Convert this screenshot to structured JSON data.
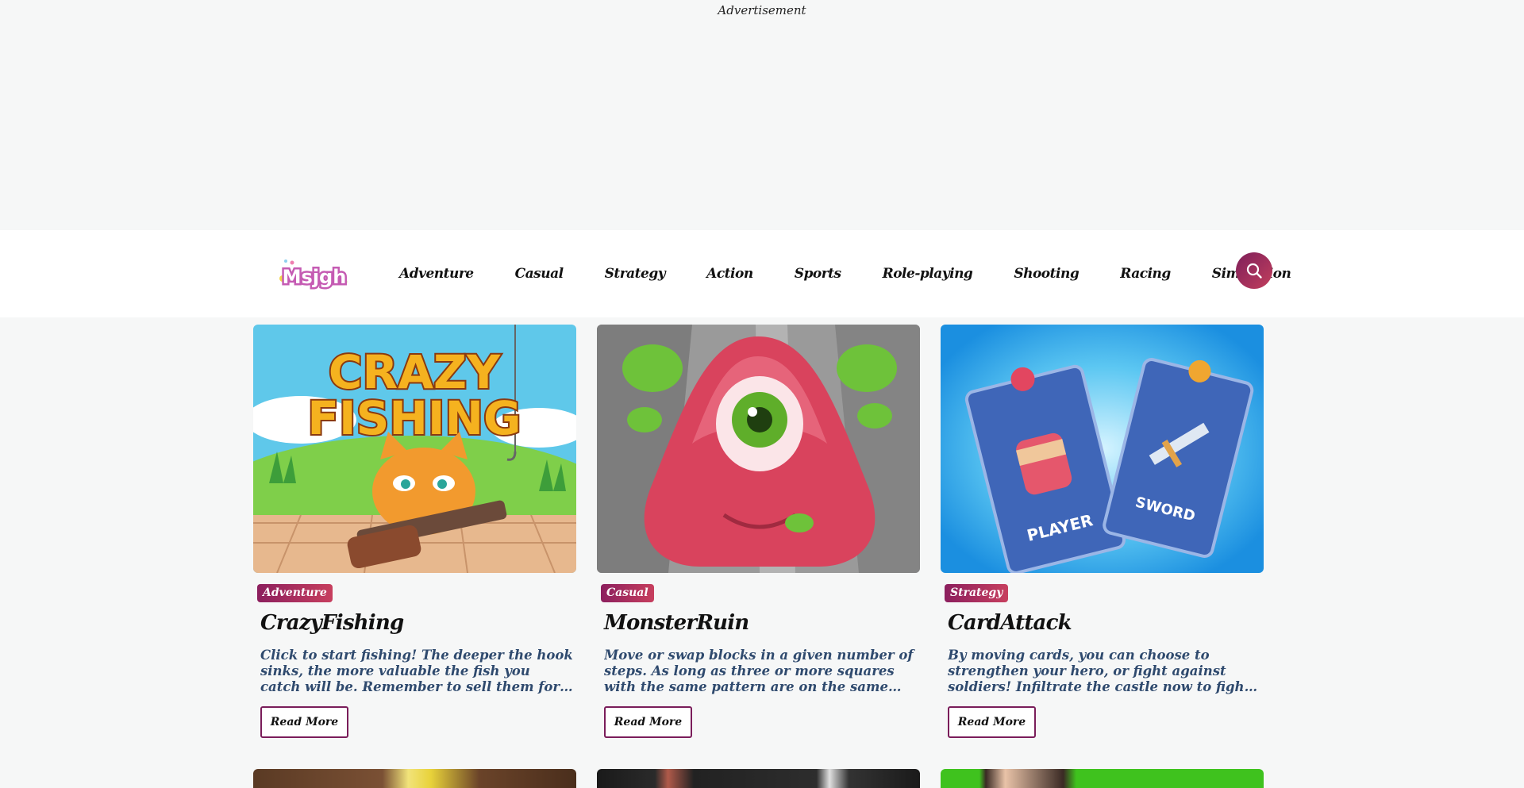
{
  "ad": {
    "label": "Advertisement"
  },
  "header": {
    "logo_text": "Msjgh",
    "nav": [
      "Adventure",
      "Casual",
      "Strategy",
      "Action",
      "Sports",
      "Role-playing",
      "Shooting",
      "Racing",
      "Simulation"
    ],
    "search_icon": "search-icon"
  },
  "cards": [
    {
      "tag": "Adventure",
      "title": "CrazyFishing",
      "thumb_text_1": "CRAZY",
      "thumb_text_2": "FISHING",
      "description": "Click to start fishing! The deeper the hook sinks, the more valuable the fish you catch will be. Remember to sell them for gold coins to replace them with more…",
      "button": "Read More"
    },
    {
      "tag": "Casual",
      "title": "MonsterRuin",
      "description": "Move or swap blocks in a given number of steps. As long as three or more squares with the same pattern are on the same line, they can be eliminated…",
      "button": "Read More"
    },
    {
      "tag": "Strategy",
      "title": "CardAttack",
      "thumb_text_1": "PLAYER",
      "thumb_text_2": "SWORD",
      "description": "By moving cards, you can choose to strengthen your hero, or fight against soldiers! Infiltrate the castle now to fight for the ultimate fortune!",
      "button": "Read More"
    }
  ],
  "colors": {
    "accent_start": "#7e1f5a",
    "accent_end": "#c23f5d",
    "desc_text": "#2f4a6e"
  }
}
